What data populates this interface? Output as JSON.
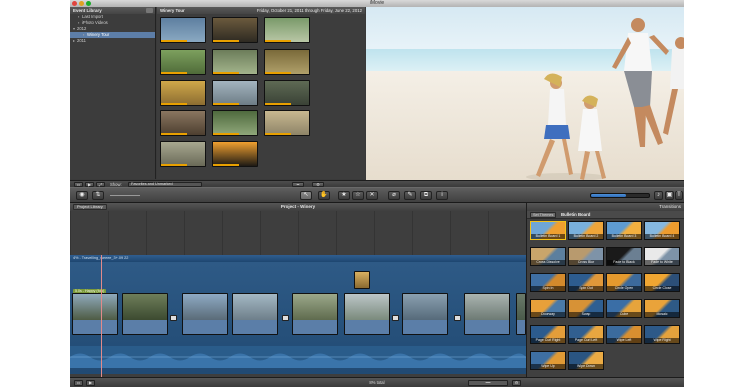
{
  "window": {
    "title": "iMovie"
  },
  "event_library": {
    "header": "Event Library",
    "items": [
      {
        "label": "Last Import",
        "expanded": false,
        "selected": false,
        "indent": 1
      },
      {
        "label": "iPhoto Videos",
        "expanded": false,
        "selected": false,
        "indent": 1
      },
      {
        "label": "2012",
        "expanded": true,
        "selected": false,
        "indent": 0
      },
      {
        "label": "Winery Tour",
        "expanded": false,
        "selected": true,
        "indent": 2
      },
      {
        "label": "2011",
        "expanded": false,
        "selected": false,
        "indent": 0
      }
    ]
  },
  "event_browser": {
    "event_name": "Winery Tour",
    "date_range": "Friday, October 21, 2011 through Friday, June 22, 2012",
    "show_label": "Show:",
    "show_value": "Favorites and Unmarked"
  },
  "toolbar": {
    "tools": [
      {
        "name": "arrow-icon",
        "glyph": "↖"
      },
      {
        "name": "hand-icon",
        "glyph": "✋"
      },
      {
        "name": "favorite-star-icon",
        "glyph": "★"
      },
      {
        "name": "unmark-star-icon",
        "glyph": "☆"
      },
      {
        "name": "reject-x-icon",
        "glyph": "✕"
      },
      {
        "name": "voiceover-mic-icon",
        "glyph": "⌀"
      },
      {
        "name": "adjust-wrench-icon",
        "glyph": "✎"
      },
      {
        "name": "crop-icon",
        "glyph": "⧉"
      },
      {
        "name": "inspector-info-icon",
        "glyph": "i"
      }
    ]
  },
  "project": {
    "library_button": "Project Library",
    "title": "Project - Winery",
    "audio_track_label": "4% - Travelling_weeee_3+.09 22",
    "music_tag": "5.0s - Happy (folk)",
    "total_label": "8% total",
    "ruler_labels": [
      "0s",
      "10s",
      "20s",
      "30s",
      "40s",
      "50s",
      "60s",
      "70s",
      "80s",
      "90s",
      "100s"
    ]
  },
  "transitions": {
    "header_right": "Transitions",
    "themes_button": "Set Themes",
    "section_title": "Bulletin Board",
    "cells": [
      {
        "label": "Bulletin Board 1",
        "colors": [
          "#6fa6d6",
          "#f0a030"
        ]
      },
      {
        "label": "Bulletin Board 2",
        "colors": [
          "#79b0dc",
          "#eea53a"
        ]
      },
      {
        "label": "Bulletin Board 3",
        "colors": [
          "#5e9bd1",
          "#f2b040"
        ]
      },
      {
        "label": "Bulletin Board 4",
        "colors": [
          "#86b8e0",
          "#ee9c2e"
        ]
      },
      {
        "label": "Cross Dissolve",
        "colors": [
          "#c9a56b",
          "#5c7f9e"
        ]
      },
      {
        "label": "Cross Blur",
        "colors": [
          "#b89a6e",
          "#7e93a8"
        ]
      },
      {
        "label": "Fade to Black",
        "colors": [
          "#1a1a1a",
          "#6b7f92"
        ]
      },
      {
        "label": "Fade to White",
        "colors": [
          "#e9e9e9",
          "#7e93a8"
        ]
      },
      {
        "label": "Spin In",
        "colors": [
          "#3f6fa3",
          "#d48a2c"
        ]
      },
      {
        "label": "Spin Out",
        "colors": [
          "#2d5c8f",
          "#e0983a"
        ]
      },
      {
        "label": "Circle Open",
        "colors": [
          "#e59a2e",
          "#3c6a9c"
        ]
      },
      {
        "label": "Circle Close",
        "colors": [
          "#f0a632",
          "#2c4f78"
        ]
      },
      {
        "label": "Doorway",
        "colors": [
          "#e8a03a",
          "#4a7aa8"
        ]
      },
      {
        "label": "Swap",
        "colors": [
          "#d79236",
          "#2f5f92"
        ]
      },
      {
        "label": "Cube",
        "colors": [
          "#3a6ea6",
          "#e6a43c"
        ]
      },
      {
        "label": "Mosaic",
        "colors": [
          "#e9a33a",
          "#2e5a86"
        ]
      },
      {
        "label": "Page Curl Right",
        "colors": [
          "#2c5b8e",
          "#e39d3a"
        ]
      },
      {
        "label": "Page Curl Left",
        "colors": [
          "#315f90",
          "#e8a640"
        ]
      },
      {
        "label": "Wipe Left",
        "colors": [
          "#3b6b9e",
          "#d88f30"
        ]
      },
      {
        "label": "Wipe Right",
        "colors": [
          "#2d5988",
          "#e4a23c"
        ]
      },
      {
        "label": "Wipe Up",
        "colors": [
          "#3e6fa2",
          "#e09a35"
        ]
      },
      {
        "label": "Wipe Down",
        "colors": [
          "#2a5582",
          "#ebab44"
        ]
      }
    ]
  },
  "bottom_bar": {
    "center_label": "8% total"
  }
}
